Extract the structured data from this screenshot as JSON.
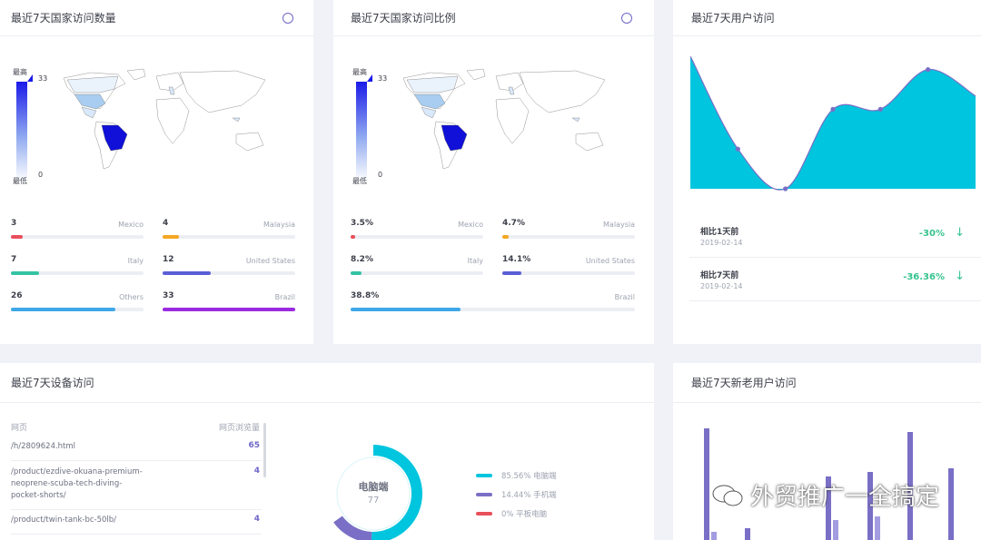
{
  "cards": {
    "country_count": {
      "title": "最近7天国家访问数量",
      "legend_high": "最高",
      "legend_low": "最低",
      "legend_max": "33",
      "legend_min": "0",
      "stats": [
        {
          "value": "3",
          "label": "Mexico",
          "fraction": 0.09,
          "color": "#e8505b"
        },
        {
          "value": "4",
          "label": "Malaysia",
          "fraction": 0.12,
          "color": "#f5a623"
        },
        {
          "value": "7",
          "label": "Italy",
          "fraction": 0.21,
          "color": "#34c3a3"
        },
        {
          "value": "12",
          "label": "United States",
          "fraction": 0.36,
          "color": "#5b5fd6"
        },
        {
          "value": "26",
          "label": "Others",
          "fraction": 0.79,
          "color": "#3ea8e8"
        },
        {
          "value": "33",
          "label": "Brazil",
          "fraction": 1.0,
          "color": "#9b2be0"
        }
      ]
    },
    "country_ratio": {
      "title": "最近7天国家访问比例",
      "legend_high": "最高",
      "legend_low": "最低",
      "legend_max": "33",
      "legend_min": "0",
      "stats": [
        {
          "value": "3.5%",
          "label": "Mexico",
          "fraction": 0.035,
          "color": "#e8505b"
        },
        {
          "value": "4.7%",
          "label": "Malaysia",
          "fraction": 0.047,
          "color": "#f5a623"
        },
        {
          "value": "8.2%",
          "label": "Italy",
          "fraction": 0.082,
          "color": "#34c3a3"
        },
        {
          "value": "14.1%",
          "label": "United States",
          "fraction": 0.141,
          "color": "#5b5fd6"
        },
        {
          "value": "38.8%",
          "label": "Brazil",
          "fraction": 0.388,
          "color": "#3ea8e8"
        }
      ]
    },
    "user_visits": {
      "title": "最近7天用户访问",
      "color": "#00c5de",
      "line_color": "#7a6fc6",
      "compare": [
        {
          "title": "相比1天前",
          "date": "2019-02-14",
          "value": "-30%",
          "arrow": "↓"
        },
        {
          "title": "相比7天前",
          "date": "2019-02-14",
          "value": "-36.36%",
          "arrow": "↓"
        }
      ]
    },
    "device": {
      "title": "最近7天设备访问",
      "col_page": "网页",
      "col_views": "网页浏览量",
      "rows": [
        {
          "path": "/h/2809624.html",
          "count": "65"
        },
        {
          "path": "/product/ezdive-okuana-premium-neoprene-scuba-tech-diving-pocket-shorts/",
          "count": "4"
        },
        {
          "path": "/product/twin-tank-bc-50lb/",
          "count": "4"
        }
      ],
      "donut_center_label": "电脑端",
      "donut_center_value": "77",
      "donut_fractions": [
        0.8556,
        0.1444,
        0.0
      ],
      "legend": [
        {
          "label": "85.56% 电脑端",
          "color": "#00c5de"
        },
        {
          "label": "14.44% 手机端",
          "color": "#7a6fc6"
        },
        {
          "label": "0% 平板电脑",
          "color": "#e8505b"
        }
      ]
    },
    "new_old": {
      "title": "最近7天新老用户访问"
    }
  },
  "watermark": "外贸推广一全搞定",
  "chart_data": [
    {
      "type": "area",
      "title": "最近7天用户访问",
      "x": [
        1,
        2,
        3,
        4,
        5,
        6,
        7
      ],
      "series": [
        {
          "values": [
            10,
            3,
            0,
            6,
            6,
            9,
            7
          ]
        }
      ],
      "ylim": [
        0,
        10
      ]
    },
    {
      "type": "pie",
      "title": "最近7天设备访问",
      "categories": [
        "电脑端",
        "手机端",
        "平板电脑"
      ],
      "values": [
        85.56,
        14.44,
        0
      ]
    },
    {
      "type": "bar",
      "title": "最近7天新老用户访问",
      "series": [
        {
          "values": [
            28,
            3,
            16,
            17,
            27,
            18
          ]
        },
        {
          "values": [
            2,
            0,
            5,
            6,
            0,
            0
          ]
        }
      ]
    }
  ]
}
